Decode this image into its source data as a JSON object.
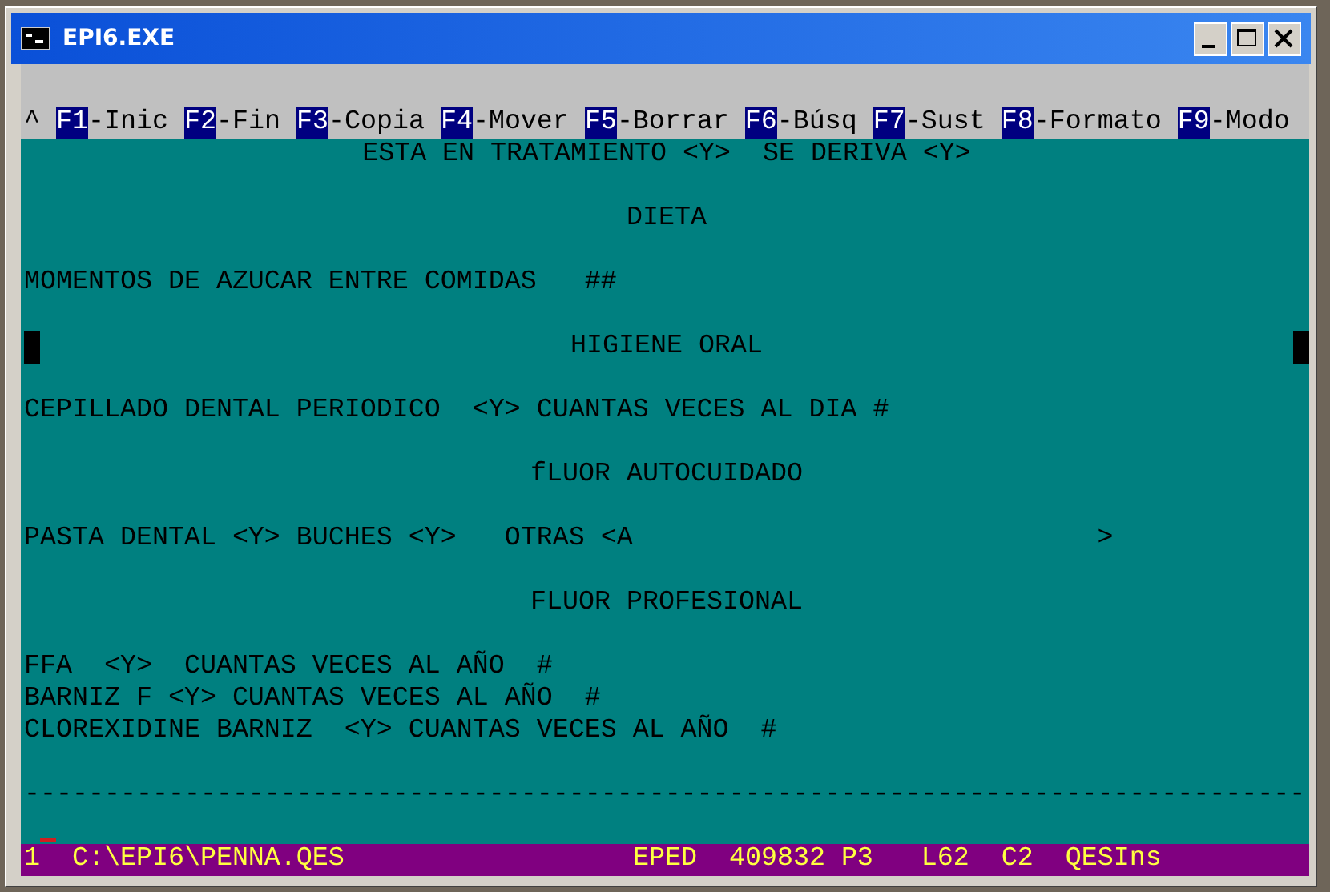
{
  "window": {
    "title": "EPI6.EXE"
  },
  "menu": {
    "prefix": "^",
    "items": [
      {
        "key": "F1",
        "label": "-Inic"
      },
      {
        "key": "F2",
        "label": "-Fin"
      },
      {
        "key": "F3",
        "label": "-Copia"
      },
      {
        "key": "F4",
        "label": "-Mover"
      },
      {
        "key": "F5",
        "label": "-Borrar"
      },
      {
        "key": "F6",
        "label": "-Búsq"
      },
      {
        "key": "F7",
        "label": "-Sust"
      },
      {
        "key": "F8",
        "label": "-Formato"
      },
      {
        "key": "F9",
        "label": "-Modo"
      }
    ]
  },
  "lines": [
    {
      "kind": "centered",
      "text": "ESTA EN TRATAMIENTO <Y>  SE DERIVA <Y>",
      "marked": false
    },
    {
      "kind": "blank"
    },
    {
      "kind": "centered",
      "text": "DIETA",
      "marked": false
    },
    {
      "kind": "blank"
    },
    {
      "kind": "text",
      "text": "MOMENTOS DE AZUCAR ENTRE COMIDAS   ##"
    },
    {
      "kind": "blank"
    },
    {
      "kind": "centered",
      "text": "HIGIENE ORAL",
      "marked": true
    },
    {
      "kind": "blank"
    },
    {
      "kind": "text",
      "text": "CEPILLADO DENTAL PERIODICO  <Y> CUANTAS VECES AL DIA #"
    },
    {
      "kind": "blank"
    },
    {
      "kind": "centered",
      "text": "fLUOR AUTOCUIDADO",
      "marked": false
    },
    {
      "kind": "blank"
    },
    {
      "kind": "text",
      "text": "PASTA DENTAL <Y> BUCHES <Y>   OTRAS <A                             >"
    },
    {
      "kind": "blank"
    },
    {
      "kind": "centered",
      "text": "FLUOR PROFESIONAL",
      "marked": false
    },
    {
      "kind": "blank"
    },
    {
      "kind": "text",
      "text": "FFA  <Y>  CUANTAS VECES AL AÑO  #"
    },
    {
      "kind": "text",
      "text": "BARNIZ F <Y> CUANTAS VECES AL AÑO  #"
    },
    {
      "kind": "text",
      "text": "CLOREXIDINE BARNIZ  <Y> CUANTAS VECES AL AÑO  #"
    },
    {
      "kind": "blank"
    },
    {
      "kind": "rule",
      "text": "--------------------------------------------------------------------------------"
    },
    {
      "kind": "cursor"
    }
  ],
  "status_bar": {
    "left": "1  C:\\EPI6\\PENNA.QES",
    "right": "EPED  409832 P3   L62  C2  QESIns"
  }
}
